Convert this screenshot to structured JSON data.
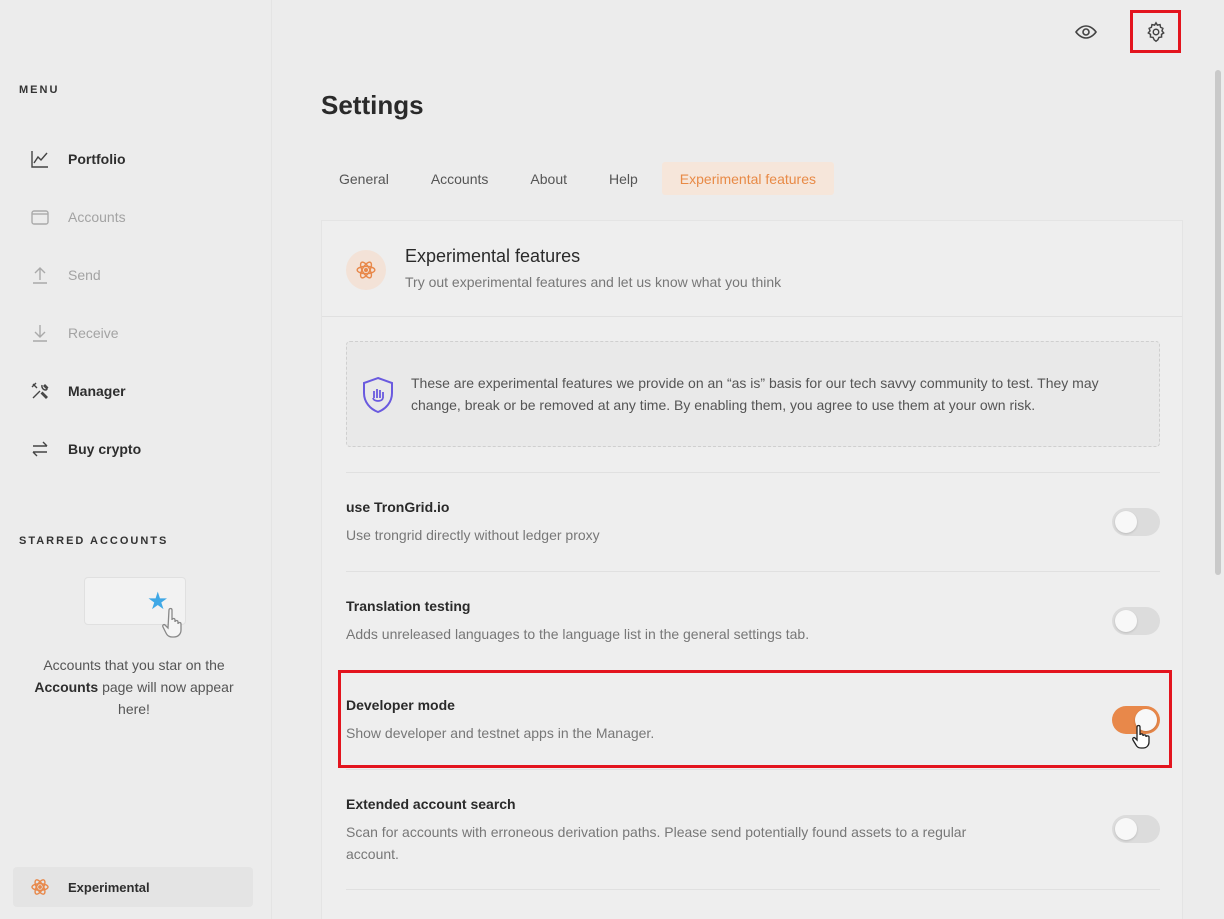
{
  "sidebar": {
    "menu_heading": "MENU",
    "items": [
      {
        "label": "Portfolio",
        "icon": "chart-line-icon"
      },
      {
        "label": "Accounts",
        "icon": "wallet-icon"
      },
      {
        "label": "Send",
        "icon": "arrow-up-icon"
      },
      {
        "label": "Receive",
        "icon": "arrow-down-icon"
      },
      {
        "label": "Manager",
        "icon": "tools-icon"
      },
      {
        "label": "Buy crypto",
        "icon": "swap-arrows-icon"
      }
    ],
    "starred_heading": "STARRED ACCOUNTS",
    "starred_text_1": "Accounts that you star on the",
    "starred_text_bold": "Accounts",
    "starred_text_2": "page will now appear here!",
    "footer_label": "Experimental"
  },
  "header": {
    "eye_icon": "eye-icon",
    "gear_icon": "gear-icon"
  },
  "main": {
    "title": "Settings",
    "tabs": [
      {
        "label": "General",
        "active": false
      },
      {
        "label": "Accounts",
        "active": false
      },
      {
        "label": "About",
        "active": false
      },
      {
        "label": "Help",
        "active": false
      },
      {
        "label": "Experimental features",
        "active": true
      }
    ],
    "card": {
      "title": "Experimental features",
      "subtitle": "Try out experimental features and let us know what you think",
      "notice": "These are experimental features we provide on an “as is” basis for our tech savvy community to test. They may change, break or be removed at any time. By enabling them, you agree to use them at your own risk.",
      "settings": [
        {
          "title": "use TronGrid.io",
          "desc": "Use trongrid directly without ledger proxy",
          "enabled": false
        },
        {
          "title": "Translation testing",
          "desc": "Adds unreleased languages to the language list in the general settings tab.",
          "enabled": false
        },
        {
          "title": "Developer mode",
          "desc": "Show developer and testnet apps in the Manager.",
          "enabled": true
        },
        {
          "title": "Extended account search",
          "desc": "Scan for accounts with erroneous derivation paths. Please send potentially found assets to a regular account.",
          "enabled": false
        }
      ]
    }
  },
  "colors": {
    "accent": "#e8884a",
    "highlight": "#e3141e",
    "shield": "#6a5adf"
  }
}
